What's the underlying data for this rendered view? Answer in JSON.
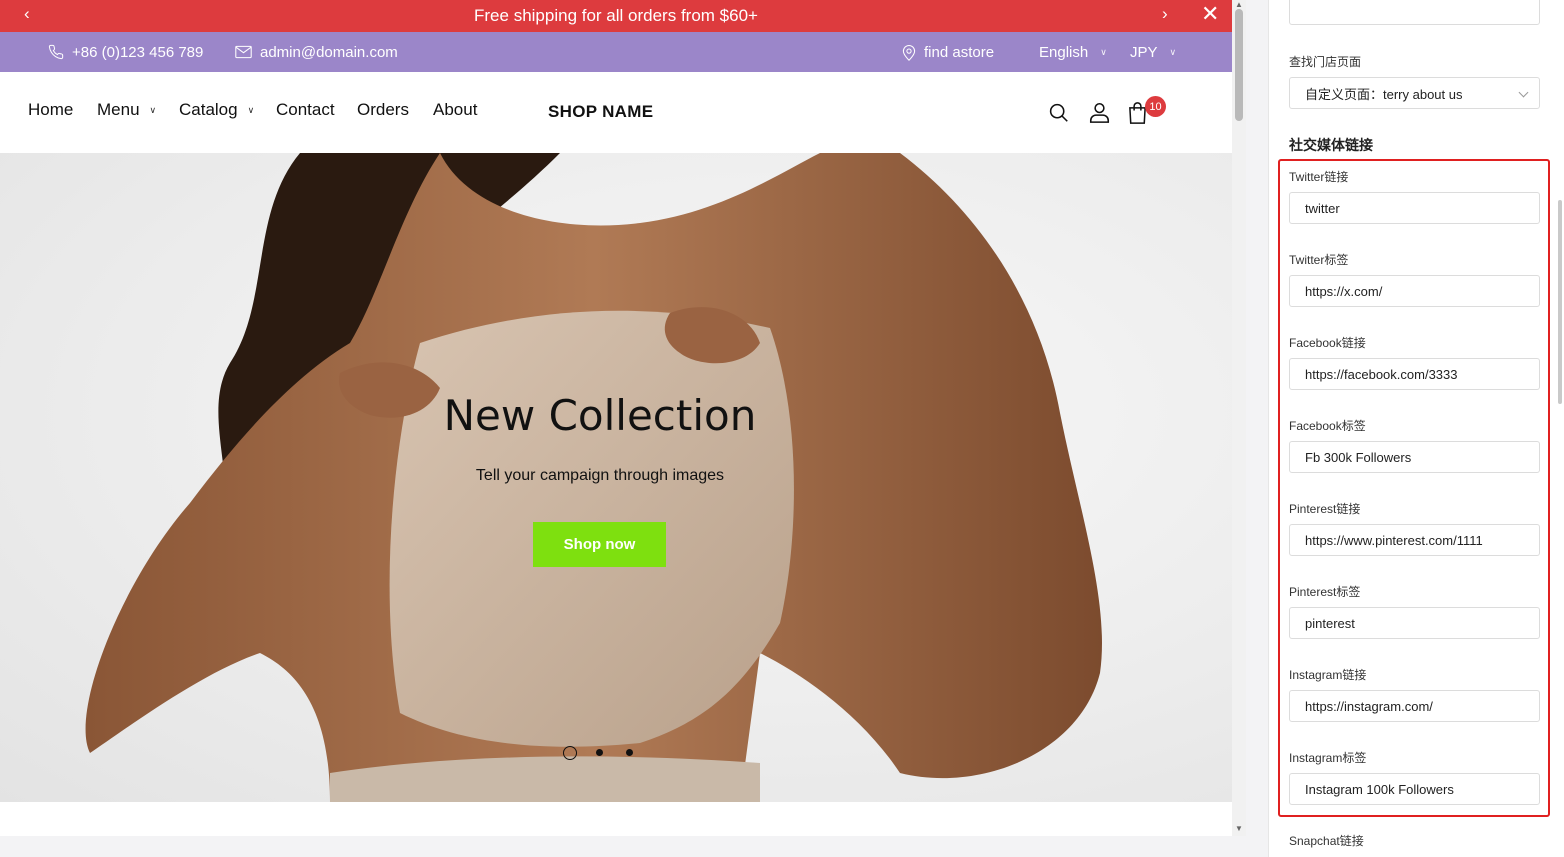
{
  "announcement": {
    "text": "Free shipping for all orders from $60+"
  },
  "topbar": {
    "phone": "+86 (0)123 456 789",
    "email": "admin@domain.com",
    "store_locator": "find astore",
    "language": "English",
    "currency": "JPY"
  },
  "nav": {
    "items": [
      {
        "label": "Home"
      },
      {
        "label": "Menu"
      },
      {
        "label": "Catalog"
      },
      {
        "label": "Contact"
      },
      {
        "label": "Orders"
      },
      {
        "label": "About"
      }
    ],
    "shop_name": "SHOP NAME",
    "cart_count": "10"
  },
  "hero": {
    "title": "New Collection",
    "subtitle": "Tell your campaign through images",
    "button": "Shop now",
    "button_color": "#7ee00f",
    "slides_total": 3,
    "active_slide": 1
  },
  "colors": {
    "announcement_bg": "#dd3b3e",
    "topbar_bg": "#9b86c9",
    "highlight_border": "#e02020"
  },
  "panel": {
    "store_page_label": "查找门店页面",
    "store_page_value": "自定义页面：terry about us",
    "social_section_title": "社交媒体链接",
    "social_fields": [
      {
        "label": "Twitter链接",
        "value": "twitter"
      },
      {
        "label": "Twitter标签",
        "value": "https://x.com/"
      },
      {
        "label": "Facebook链接",
        "value": "https://facebook.com/3333"
      },
      {
        "label": "Facebook标签",
        "value": "Fb 300k Followers"
      },
      {
        "label": "Pinterest链接",
        "value": "https://www.pinterest.com/1111"
      },
      {
        "label": "Pinterest标签",
        "value": "pinterest"
      },
      {
        "label": "Instagram链接",
        "value": "https://instagram.com/"
      },
      {
        "label": "Instagram标签",
        "value": "Instagram 100k Followers"
      }
    ],
    "next_field_label": "Snapchat链接"
  }
}
